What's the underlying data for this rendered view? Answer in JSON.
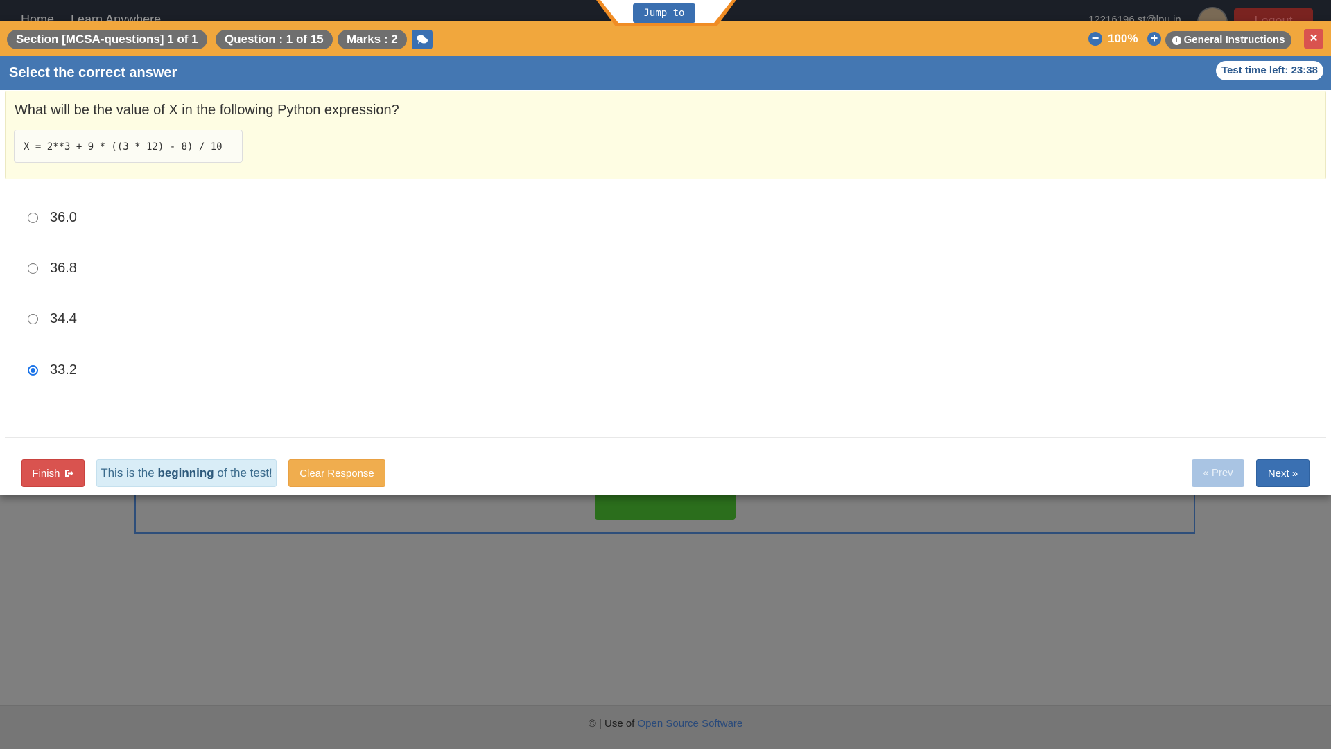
{
  "background": {
    "nav": [
      "Home",
      "Learn Anywhere"
    ],
    "user": "12216196.st@lpu.in",
    "logout_label": "Logout",
    "footer": {
      "prefix": "© | Use of",
      "link": "Open Source Software"
    }
  },
  "jump_label": "Jump to",
  "header": {
    "section": "Section [MCSA-questions] 1 of 1",
    "question": "Question : 1 of 15",
    "marks": "Marks : 2",
    "zoom": "100%",
    "instructions_label": "General Instructions",
    "close": "×"
  },
  "subheader": {
    "title": "Select the correct answer",
    "timer": "Test time left: 23:38"
  },
  "question": {
    "text": "What will be the value of X in the following Python expression?",
    "code": "X = 2**3 + 9 * ((3 * 12) - 8) / 10"
  },
  "options": [
    {
      "label": "36.0",
      "selected": false
    },
    {
      "label": "36.8",
      "selected": false
    },
    {
      "label": "34.4",
      "selected": false
    },
    {
      "label": "33.2",
      "selected": true
    }
  ],
  "footer": {
    "finish_label": "Finish",
    "info_pre": "This is the",
    "info_bold": "beginning",
    "info_post": "of the test!",
    "clear_label": "Clear Response",
    "prev_label": "Prev",
    "next_label": "Next"
  },
  "colors": {
    "orange_bar": "#f1a73d",
    "blue_bar": "#4477b2",
    "finish": "#d9534f",
    "clear": "#f0ad4e",
    "next": "#3a70b2"
  }
}
